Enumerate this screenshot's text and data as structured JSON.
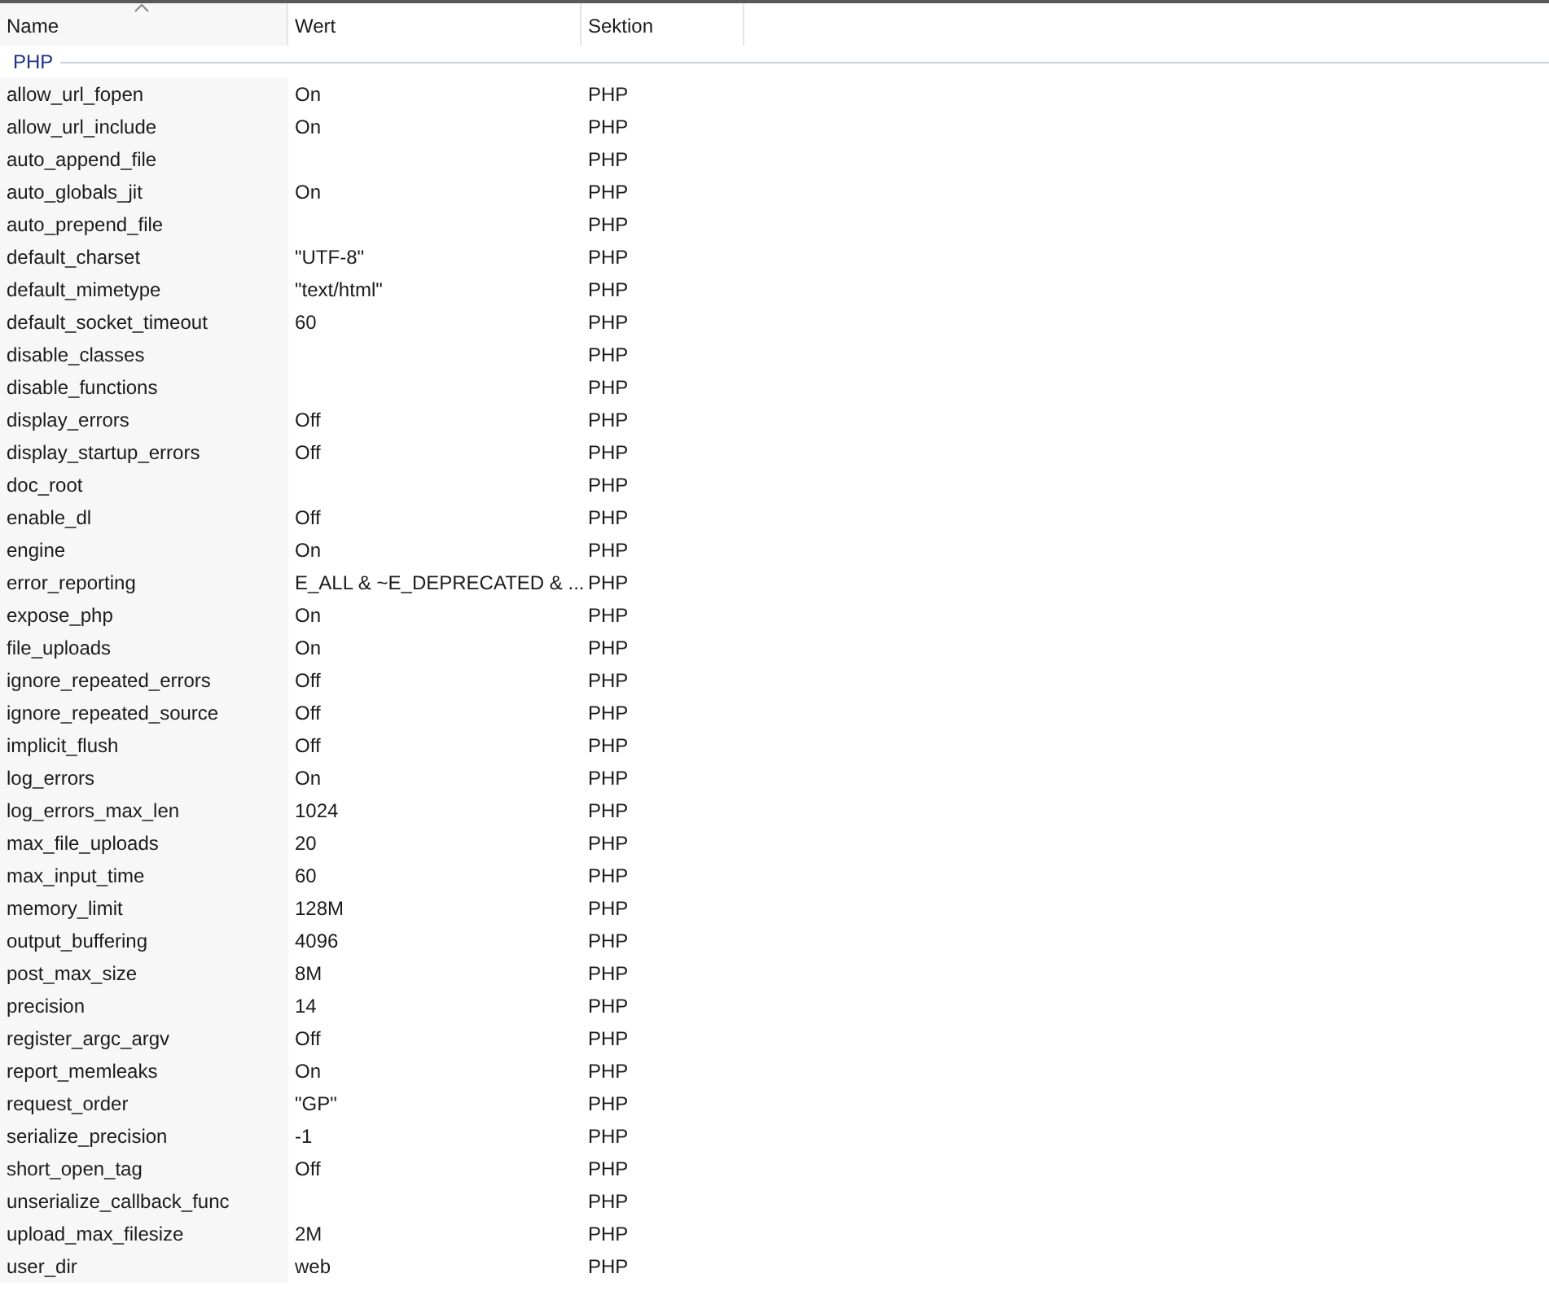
{
  "table": {
    "columns": [
      {
        "label": "Name",
        "sorted": true
      },
      {
        "label": "Wert",
        "sorted": false
      },
      {
        "label": "Sektion",
        "sorted": false
      }
    ],
    "group": {
      "label": "PHP"
    },
    "rows": [
      {
        "name": "allow_url_fopen",
        "value": "On",
        "section": "PHP"
      },
      {
        "name": "allow_url_include",
        "value": "On",
        "section": "PHP"
      },
      {
        "name": "auto_append_file",
        "section": "PHP"
      },
      {
        "name": "auto_globals_jit",
        "value": "On",
        "section": "PHP"
      },
      {
        "name": "auto_prepend_file",
        "section": "PHP"
      },
      {
        "name": "default_charset",
        "value": "\"UTF-8\"",
        "section": "PHP"
      },
      {
        "name": "default_mimetype",
        "value": "\"text/html\"",
        "section": "PHP"
      },
      {
        "name": "default_socket_timeout",
        "value": "60",
        "section": "PHP"
      },
      {
        "name": "disable_classes",
        "section": "PHP"
      },
      {
        "name": "disable_functions",
        "section": "PHP"
      },
      {
        "name": "display_errors",
        "value": "Off",
        "section": "PHP"
      },
      {
        "name": "display_startup_errors",
        "value": "Off",
        "section": "PHP"
      },
      {
        "name": "doc_root",
        "section": "PHP"
      },
      {
        "name": "enable_dl",
        "value": "Off",
        "section": "PHP"
      },
      {
        "name": "engine",
        "value": "On",
        "section": "PHP"
      },
      {
        "name": "error_reporting",
        "value": "E_ALL & ~E_DEPRECATED & ...",
        "section": "PHP"
      },
      {
        "name": "expose_php",
        "value": "On",
        "section": "PHP"
      },
      {
        "name": "file_uploads",
        "value": "On",
        "section": "PHP"
      },
      {
        "name": "ignore_repeated_errors",
        "value": "Off",
        "section": "PHP"
      },
      {
        "name": "ignore_repeated_source",
        "value": "Off",
        "section": "PHP"
      },
      {
        "name": "implicit_flush",
        "value": "Off",
        "section": "PHP"
      },
      {
        "name": "log_errors",
        "value": "On",
        "section": "PHP"
      },
      {
        "name": "log_errors_max_len",
        "value": "1024",
        "section": "PHP"
      },
      {
        "name": "max_file_uploads",
        "value": "20",
        "section": "PHP"
      },
      {
        "name": "max_input_time",
        "value": "60",
        "section": "PHP"
      },
      {
        "name": "memory_limit",
        "value": "128M",
        "section": "PHP"
      },
      {
        "name": "output_buffering",
        "value": "4096",
        "section": "PHP"
      },
      {
        "name": "post_max_size",
        "value": "8M",
        "section": "PHP"
      },
      {
        "name": "precision",
        "value": "14",
        "section": "PHP"
      },
      {
        "name": "register_argc_argv",
        "value": "Off",
        "section": "PHP"
      },
      {
        "name": "report_memleaks",
        "value": "On",
        "section": "PHP"
      },
      {
        "name": "request_order",
        "value": "\"GP\"",
        "section": "PHP"
      },
      {
        "name": "serialize_precision",
        "value": "-1",
        "section": "PHP"
      },
      {
        "name": "short_open_tag",
        "value": "Off",
        "section": "PHP"
      },
      {
        "name": "unserialize_callback_func",
        "section": "PHP"
      },
      {
        "name": "upload_max_filesize",
        "value": "2M",
        "section": "PHP"
      },
      {
        "name": "user_dir",
        "value": "web",
        "section": "PHP"
      }
    ]
  }
}
